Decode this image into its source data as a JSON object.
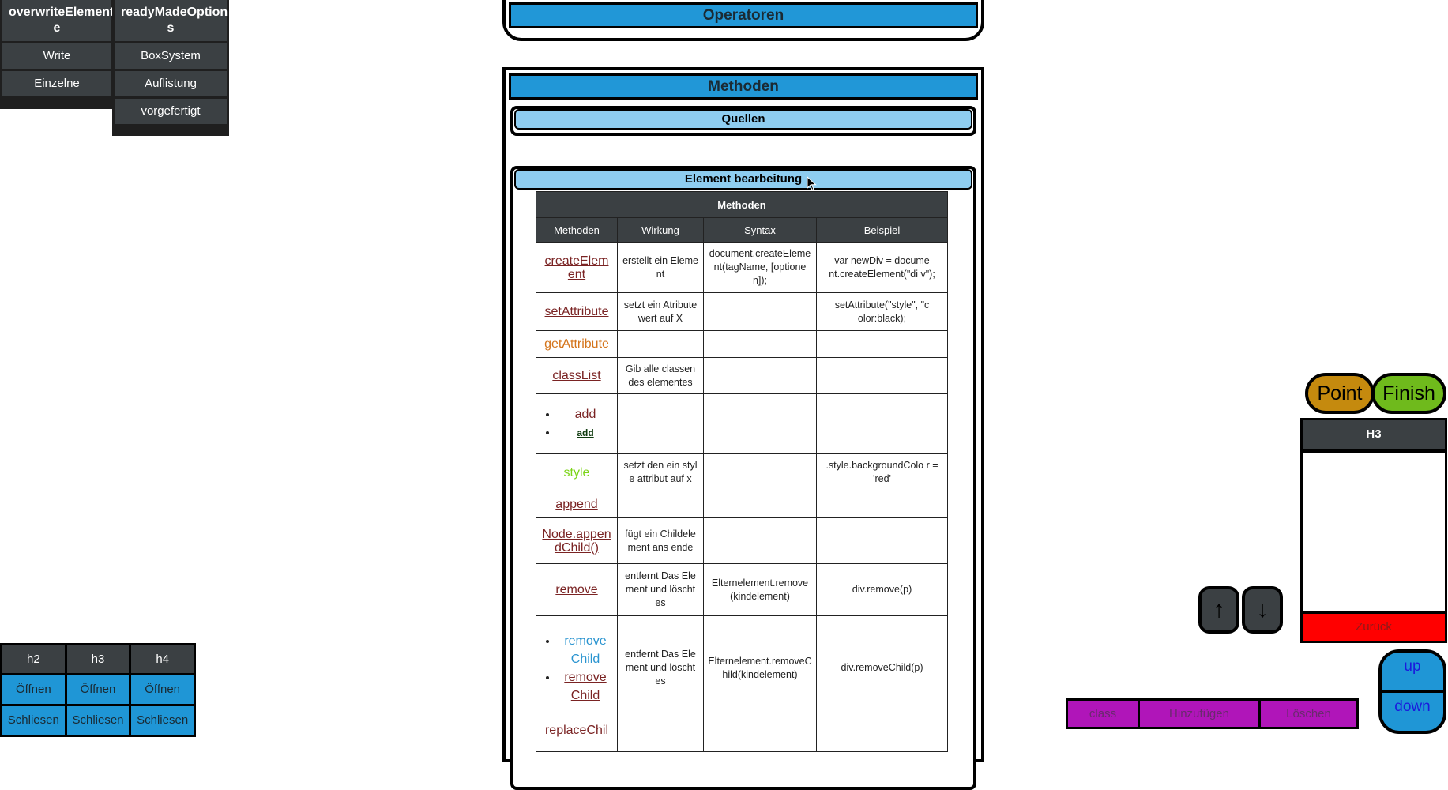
{
  "menus": {
    "left": {
      "title": "overwriteElement\ne",
      "items": [
        "Write",
        "Einzelne"
      ]
    },
    "right": {
      "title": "readyMadeOption\ns",
      "items": [
        "BoxSystem",
        "Auflistung",
        "vorgefertigt"
      ]
    }
  },
  "operatoren": {
    "title": "Operatoren"
  },
  "methoden": {
    "title": "Methoden",
    "quellen": "Quellen",
    "element_bearbeitung": "Element bearbeitung",
    "table": {
      "caption": "Methoden",
      "headers": [
        "Methoden",
        "Wirkung",
        "Syntax",
        "Beispiel"
      ],
      "rows": [
        {
          "name": "createElem ent",
          "wirkung": "erstellt ein Eleme nt",
          "syntax": "document.createEleme nt(tagName, [optione n]);",
          "beispiel": "var newDiv = docume nt.createElement(\"di v\");"
        },
        {
          "name": "setAttribute",
          "wirkung": "setzt ein Atribute wert auf X",
          "syntax": "",
          "beispiel": "setAttribute(\"style\", \"c olor:black);"
        },
        {
          "name": "getAttribute",
          "wirkung": "",
          "syntax": "",
          "beispiel": ""
        },
        {
          "name": "classList",
          "wirkung": "Gib alle classen des elementes",
          "syntax": "",
          "beispiel": ""
        },
        {
          "list": [
            "add",
            "add"
          ],
          "wirkung": "",
          "syntax": "",
          "beispiel": ""
        },
        {
          "name": "style",
          "wirkung": "setzt den ein styl e attribut auf x",
          "syntax": "",
          "beispiel": ".style.backgroundColo r = 'red'"
        },
        {
          "name": "append",
          "wirkung": "",
          "syntax": "",
          "beispiel": ""
        },
        {
          "name": "Node.appen dChild()",
          "wirkung": "fügt ein Childele ment ans ende",
          "syntax": "",
          "beispiel": ""
        },
        {
          "name": "remove",
          "wirkung": "entfernt Das Ele ment und löscht es",
          "syntax": "Elternelement.remove (kindelement)",
          "beispiel": "div.remove(p)"
        },
        {
          "list": [
            "remove Child",
            "remove Child"
          ],
          "wirkung": "entfernt Das Ele ment und löscht es",
          "syntax": "Elternelement.removeC hild(kindelement)",
          "beispiel": "div.removeChild(p)"
        },
        {
          "name": "replaceChil",
          "wirkung": "",
          "syntax": "",
          "beispiel": ""
        }
      ]
    }
  },
  "controls": {
    "point": "Point",
    "finish": "Finish",
    "h3_panel": {
      "title": "H3",
      "back": "Zurück"
    },
    "arrow_up": "↑",
    "arrow_down": "↓",
    "up": "up",
    "down": "down"
  },
  "purple_bar": [
    "class",
    "Hinzufügen",
    "Löschen"
  ],
  "heading_grid": {
    "headers": [
      "h2",
      "h3",
      "h4"
    ],
    "open": "Öffnen",
    "close": "Schliesen"
  },
  "colors": {
    "dark": "#3b4043",
    "blue": "#2197d7",
    "light_blue": "#8ecdf0",
    "point": "#c58a0e",
    "finish": "#6fba1c",
    "red": "#ff0000",
    "purple": "#b015b9"
  }
}
